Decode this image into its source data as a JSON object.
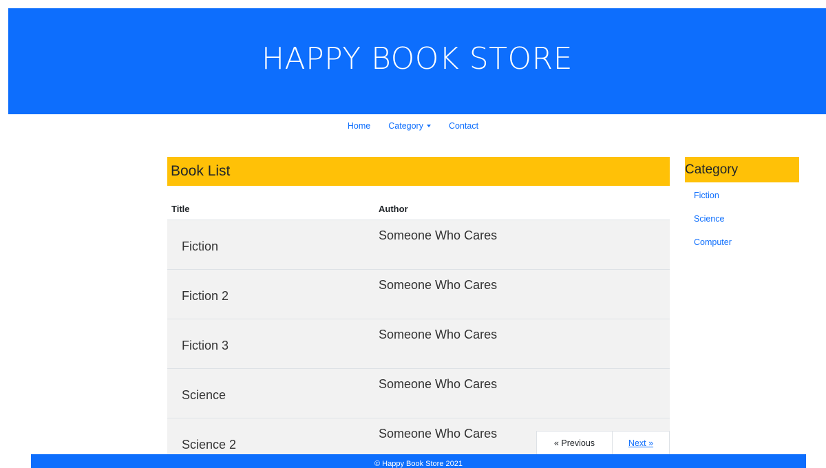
{
  "header": {
    "title": "HAPPY BOOK STORE"
  },
  "nav": {
    "items": [
      {
        "label": "Home"
      },
      {
        "label": "Category",
        "has_dropdown": true
      },
      {
        "label": "Contact"
      }
    ]
  },
  "book_list": {
    "heading": "Book List",
    "columns": [
      "Title",
      "Author"
    ],
    "rows": [
      {
        "title": "Fiction",
        "author": "Someone Who Cares"
      },
      {
        "title": "Fiction 2",
        "author": "Someone Who Cares"
      },
      {
        "title": "Fiction 3",
        "author": "Someone Who Cares"
      },
      {
        "title": "Science",
        "author": "Someone Who Cares"
      },
      {
        "title": "Science 2",
        "author": "Someone Who Cares"
      }
    ]
  },
  "pagination": {
    "previous_label": "« Previous",
    "next_label": "Next »"
  },
  "sidebar": {
    "heading": "Category",
    "items": [
      {
        "label": "Fiction"
      },
      {
        "label": "Science"
      },
      {
        "label": "Computer"
      }
    ]
  },
  "footer": {
    "text": "© Happy Book Store 2021"
  },
  "colors": {
    "primary": "#0d6efd",
    "accent": "#ffc107",
    "row_background": "#f2f2f2"
  }
}
